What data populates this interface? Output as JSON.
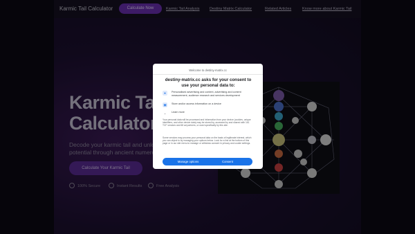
{
  "nav": {
    "brand": "Karmic Tail Calculator",
    "cta": "Calculate Now",
    "links": [
      "Karmic Tail Analysis",
      "Destiny Matrix Calculator",
      "Related Articles",
      "Know more about Karmic Tail"
    ]
  },
  "hero": {
    "title_line1": "Karmic Tail",
    "title_line2": "Calculator",
    "subtitle_line1": "Decode your karmic tail and unlock",
    "subtitle_line2": "potential through ancient numerology",
    "button": "Calculate Your Karmic Tail",
    "features": [
      "100% Secure",
      "Instant Results",
      "Free Analysis"
    ]
  },
  "consent": {
    "site": "Welcome to destiny-matrix.cc",
    "title": "destiny-matrix.cc asks for your consent to use your personal data to:",
    "purposes": [
      {
        "icon": "person-icon",
        "text": "Personalised advertising and content, advertising and content measurement, audience research and services development"
      },
      {
        "icon": "device-icon",
        "text": "Store and/or access information on a device"
      }
    ],
    "learn_more": "Learn more",
    "para1": "Your personal data will be processed and information from your device (cookies, unique identifiers, and other device data) may be stored by, accessed by and shared with 161 TCF vendors and 68 ad partners, or used specifically by this site.",
    "para2": "Some vendors may process your personal data on the basis of legitimate interest, which you can object to by managing your options below. Look for a link at the bottom of this page or in our site menu to manage or withdraw consent in privacy and cookie settings.",
    "manage_label": "Manage options",
    "consent_label": "Consent"
  },
  "colors": {
    "accent": "#6a2fb0",
    "consent_blue": "#1a73e8"
  }
}
